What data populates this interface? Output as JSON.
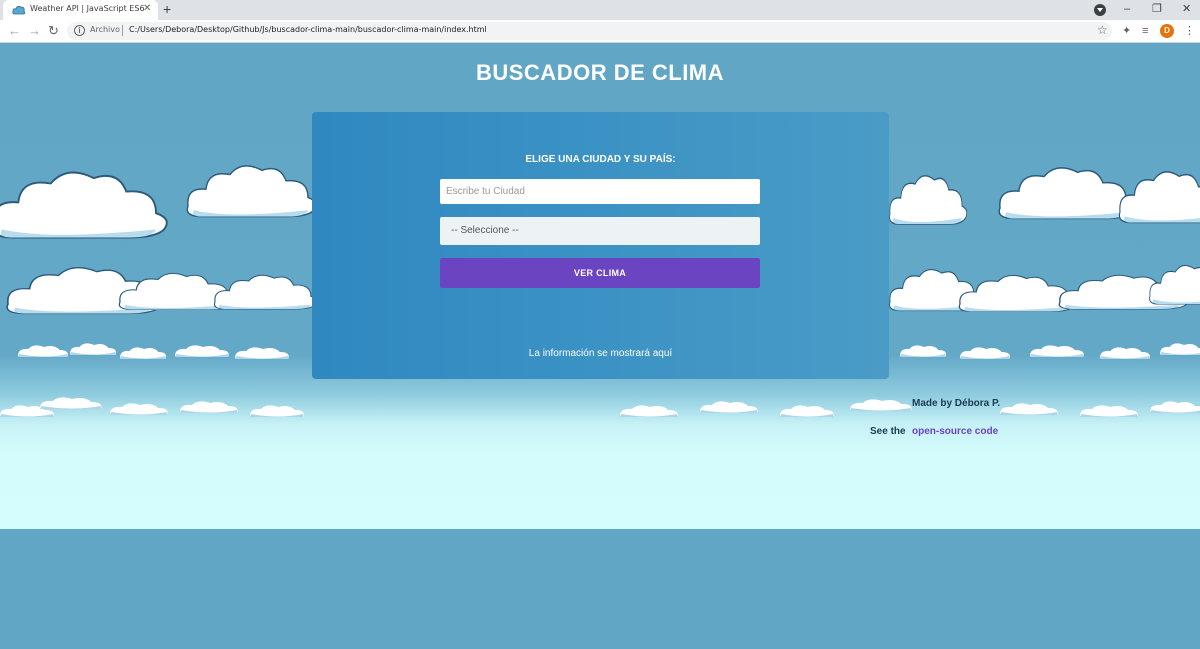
{
  "browser": {
    "tab_title": "Weather API | JavaScript ES6",
    "tab_close": "✕",
    "new_tab": "+",
    "protocol_label": "Archivo",
    "url": "C:/Users/Debora/Desktop/Github/Js/buscador-clima-main/buscador-clima-main/index.html",
    "profile_initial": "D",
    "window_min": "–",
    "window_restore": "❐",
    "window_close": "✕",
    "back": "←",
    "forward": "→",
    "reload": "↻",
    "star": "☆",
    "menu": "⋮",
    "extensions": "✦",
    "media": "≡"
  },
  "page": {
    "title": "BUSCADOR DE CLIMA",
    "form": {
      "heading": "ELIGE UNA CIUDAD Y SU PAÍS:",
      "city_placeholder": "Escribe tu Ciudad",
      "city_value": "",
      "country_selected": "-- Seleccione --",
      "submit_label": "VER CLIMA"
    },
    "result_message": "La información se mostrará aquí",
    "footer": {
      "credit": "Made by Débora P.",
      "source_prefix": "See the",
      "source_link": "open-source code"
    }
  },
  "colors": {
    "sky": "#62a6c6",
    "card": "#3a91c4",
    "button": "#6b44c2",
    "link": "#6b44c2",
    "horizon": "#d6fdfd"
  }
}
